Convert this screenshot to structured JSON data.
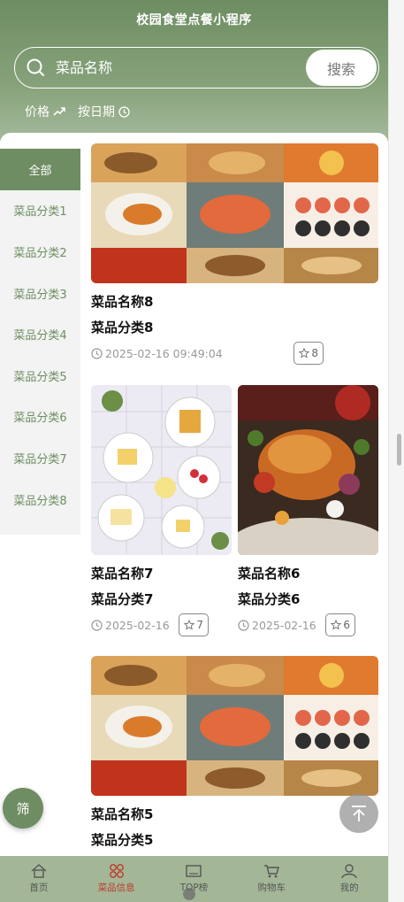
{
  "app": {
    "title": "校园食堂点餐小程序"
  },
  "search": {
    "placeholder": "菜品名称",
    "button": "搜索"
  },
  "sorts": [
    {
      "label": "价格",
      "icon": "trend-up-icon"
    },
    {
      "label": "按日期",
      "icon": "clock-icon"
    }
  ],
  "sidebar": {
    "items": [
      {
        "label": "全部"
      },
      {
        "label": "菜品分类1"
      },
      {
        "label": "菜品分类2"
      },
      {
        "label": "菜品分类3"
      },
      {
        "label": "菜品分类4"
      },
      {
        "label": "菜品分类5"
      },
      {
        "label": "菜品分类6"
      },
      {
        "label": "菜品分类7"
      },
      {
        "label": "菜品分类8"
      }
    ]
  },
  "dishes": [
    {
      "name": "菜品名称8",
      "category": "菜品分类8",
      "date": "2025-02-16 09:49:04",
      "favorites": "8"
    },
    {
      "name": "菜品名称7",
      "category": "菜品分类7",
      "date": "2025-02-16",
      "favorites": "7"
    },
    {
      "name": "菜品名称6",
      "category": "菜品分类6",
      "date": "2025-02-16",
      "favorites": "6"
    },
    {
      "name": "菜品名称5",
      "category": "菜品分类5"
    }
  ],
  "floating": {
    "filter": "筛"
  },
  "tabbar": [
    {
      "label": "首页",
      "icon": "home-icon"
    },
    {
      "label": "菜品信息",
      "icon": "grid-icon"
    },
    {
      "label": "TOP榜",
      "icon": "ranking-icon"
    },
    {
      "label": "购物车",
      "icon": "cart-icon"
    },
    {
      "label": "我的",
      "icon": "user-icon"
    }
  ],
  "colors": {
    "primary": "#6e8d62",
    "tabbar": "#a3b797",
    "active_tab": "#c0392b"
  }
}
